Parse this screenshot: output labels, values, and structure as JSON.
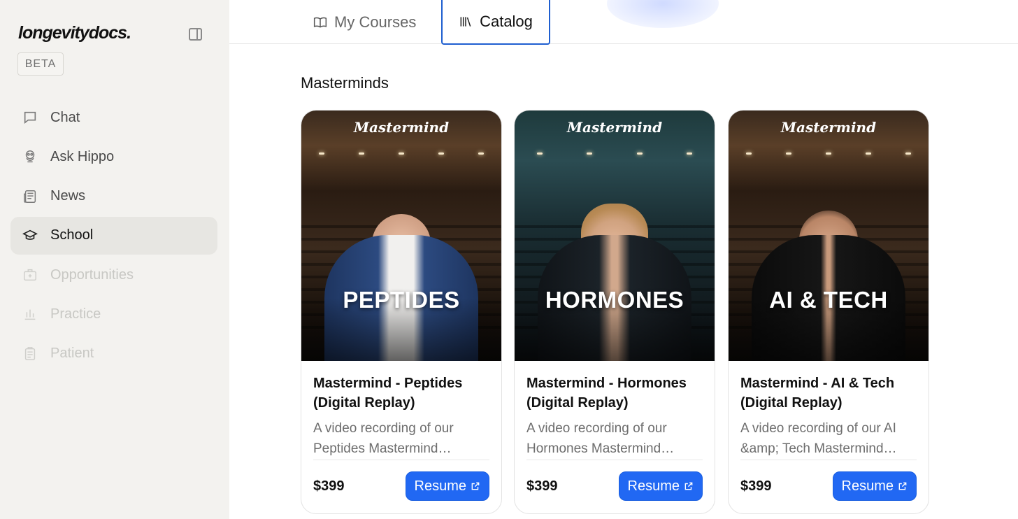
{
  "brand": {
    "logo": "longevitydocs.",
    "badge": "BETA"
  },
  "sidebar": {
    "items": [
      {
        "label": "Chat",
        "icon": "chat-icon",
        "state": "normal"
      },
      {
        "label": "Ask Hippo",
        "icon": "hippo-icon",
        "state": "normal"
      },
      {
        "label": "News",
        "icon": "newspaper-icon",
        "state": "normal"
      },
      {
        "label": "School",
        "icon": "graduation-cap-icon",
        "state": "active"
      },
      {
        "label": "Opportunities",
        "icon": "briefcase-icon",
        "state": "disabled"
      },
      {
        "label": "Practice",
        "icon": "bar-chart-icon",
        "state": "disabled"
      },
      {
        "label": "Patient",
        "icon": "clipboard-icon",
        "state": "disabled"
      }
    ]
  },
  "tabs": {
    "my_courses": "My Courses",
    "catalog": "Catalog",
    "active": "Catalog"
  },
  "main": {
    "section_title": "Masterminds",
    "cards": [
      {
        "image_logo": "Mastermind",
        "image_title": "PEPTIDES",
        "title": "Mastermind - Peptides (Digital Replay)",
        "description": "A video recording of our Peptides Mastermind…",
        "price": "$399",
        "button": "Resume"
      },
      {
        "image_logo": "Mastermind",
        "image_title": "HORMONES",
        "title": "Mastermind - Hormones (Digital Replay)",
        "description": "A video recording of our Hormones Mastermind…",
        "price": "$399",
        "button": "Resume"
      },
      {
        "image_logo": "Mastermind",
        "image_title": "AI & TECH",
        "title": "Mastermind - AI & Tech (Digital Replay)",
        "description": "A video recording of our AI &amp; Tech Mastermind…",
        "price": "$399",
        "button": "Resume"
      }
    ]
  },
  "colors": {
    "accent": "#2168f3",
    "sidebar_bg": "#f3f2ef",
    "tab_border": "#1f5fd0"
  }
}
